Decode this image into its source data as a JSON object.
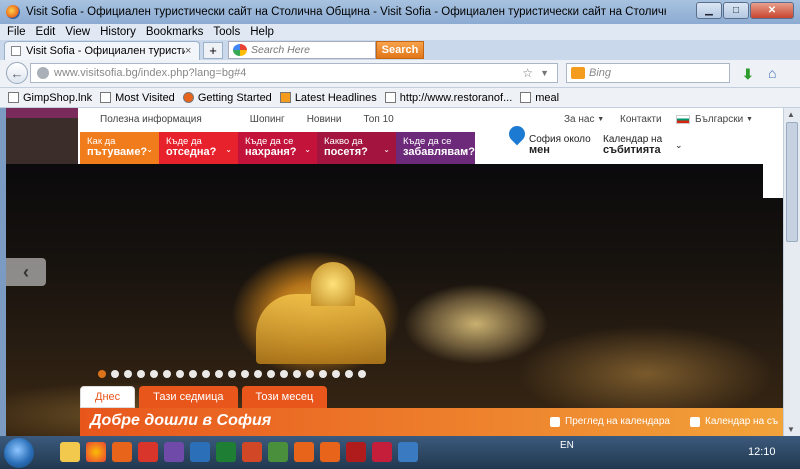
{
  "window": {
    "title": "Visit Sofia - Официален туристически сайт на Столична Община - Visit Sofia - Официален туристически сайт на Столична Община - Mozilla Firefox",
    "minimize": "▁",
    "maximize": "□",
    "close": "✕"
  },
  "menubar": {
    "items": [
      "File",
      "Edit",
      "View",
      "History",
      "Bookmarks",
      "Tools",
      "Help"
    ]
  },
  "tab": {
    "title": "Visit Sofia - Официален туристически с...",
    "close": "×",
    "new_tab": "+"
  },
  "search": {
    "placeholder": "Search Here",
    "button": "Search"
  },
  "nav": {
    "back": "←",
    "url": "www.visitsofia.bg/index.php?lang=bg#4",
    "star": "☆",
    "drop": "▼",
    "bing_placeholder": "Bing",
    "download": "⬇",
    "home": "⌂"
  },
  "bookmarks": [
    "GimpShop.lnk",
    "Most Visited",
    "Getting Started",
    "Latest Headlines",
    "http://www.restoranof...",
    "meal"
  ],
  "site": {
    "toplinks": {
      "useful": "Полезна информация",
      "shopping": "Шопинг",
      "news": "Новини",
      "top10": "Топ 10",
      "about": "За нас",
      "contacts": "Контакти",
      "language": "Български"
    },
    "menu": [
      {
        "line1": "Как да",
        "line2": "пътуваме?",
        "color": "#f07c1c"
      },
      {
        "line1": "Къде да",
        "line2": "отседна?",
        "color": "#e8222d"
      },
      {
        "line1": "Къде да се",
        "line2": "нахраня?",
        "color": "#c4133b"
      },
      {
        "line1": "Какво да",
        "line2": "посетя?",
        "color": "#a3143f"
      },
      {
        "line1": "Къде да се",
        "line2": "забавлявам?",
        "color": "#6e2a7a"
      }
    ],
    "near": {
      "line1": "София около",
      "line2": "мен"
    },
    "calendar": {
      "line1": "Календар на",
      "line2": "събитията"
    },
    "slider": {
      "prev": "‹",
      "dots": 21,
      "active_dot": 0
    },
    "tabs": [
      "Днес",
      "Тази седмица",
      "Този месец"
    ],
    "banner": {
      "title": "Добре дошли в София",
      "calendar_view": "Преглед на календара",
      "calendar_download": "Календар на съ"
    }
  },
  "taskbar": {
    "language": "EN",
    "time": "12:10"
  }
}
